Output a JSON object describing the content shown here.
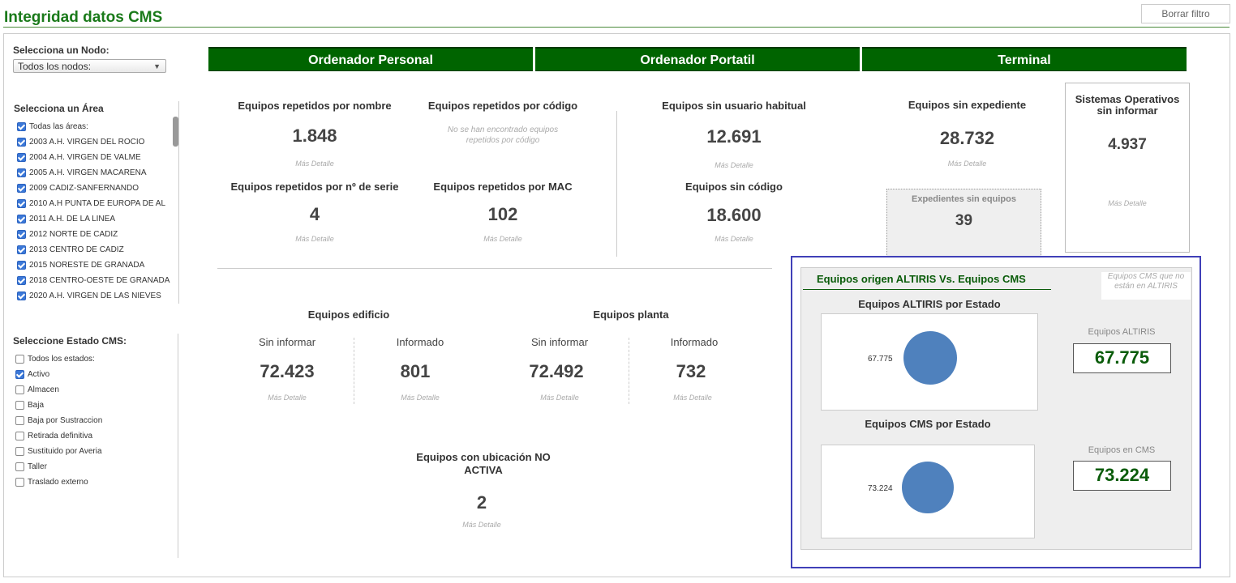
{
  "page": {
    "title": "Integridad datos CMS",
    "clear_filter": "Borrar filtro"
  },
  "filters": {
    "node_label": "Selecciona un Nodo:",
    "node_value": "Todos los nodos:",
    "area_label": "Selecciona un Área",
    "areas": [
      {
        "label": "Todas las áreas:",
        "checked": true
      },
      {
        "label": "2003 A.H. VIRGEN DEL ROCIO",
        "checked": true
      },
      {
        "label": "2004 A.H. VIRGEN DE VALME",
        "checked": true
      },
      {
        "label": "2005 A.H. VIRGEN MACARENA",
        "checked": true
      },
      {
        "label": "2009 CADIZ-SANFERNANDO",
        "checked": true
      },
      {
        "label": "2010 A.H PUNTA DE EUROPA DE AL",
        "checked": true
      },
      {
        "label": "2011 A.H. DE LA LINEA",
        "checked": true
      },
      {
        "label": "2012 NORTE DE CADIZ",
        "checked": true
      },
      {
        "label": "2013 CENTRO DE CADIZ",
        "checked": true
      },
      {
        "label": "2015 NORESTE DE GRANADA",
        "checked": true
      },
      {
        "label": "2018 CENTRO-OESTE DE GRANADA",
        "checked": true
      },
      {
        "label": "2020 A.H. VIRGEN DE LAS NIEVES",
        "checked": true
      }
    ],
    "estado_label": "Seleccione Estado CMS:",
    "estados": [
      {
        "label": "Todos los estados:",
        "checked": false
      },
      {
        "label": "Activo",
        "checked": true
      },
      {
        "label": "Almacen",
        "checked": false
      },
      {
        "label": "Baja",
        "checked": false
      },
      {
        "label": "Baja por Sustraccion",
        "checked": false
      },
      {
        "label": "Retirada definitiva",
        "checked": false
      },
      {
        "label": "Sustituido por Averia",
        "checked": false
      },
      {
        "label": "Taller",
        "checked": false
      },
      {
        "label": "Traslado externo",
        "checked": false
      }
    ]
  },
  "tabs": {
    "pc": "Ordenador Personal",
    "portatil": "Ordenador Portatil",
    "terminal": "Terminal"
  },
  "detail": "Más Detalle",
  "kpis": {
    "rep_nombre": {
      "title": "Equipos repetidos por nombre",
      "value": "1.848"
    },
    "rep_codigo": {
      "title": "Equipos repetidos por código",
      "note": "No se han encontrado equipos repetidos por código"
    },
    "rep_serie": {
      "title": "Equipos repetidos por nº de serie",
      "value": "4"
    },
    "rep_mac": {
      "title": "Equipos repetidos por MAC",
      "value": "102"
    },
    "sin_usuario": {
      "title": "Equipos sin usuario habitual",
      "value": "12.691"
    },
    "sin_codigo": {
      "title": "Equipos sin código",
      "value": "18.600"
    },
    "sin_expediente": {
      "title": "Equipos sin expediente",
      "value": "28.732"
    },
    "exp_sin_equipos": {
      "title": "Expedientes sin equipos",
      "value": "39"
    },
    "so_sin_informar": {
      "title": "Sistemas Operativos sin informar",
      "value": "4.937"
    },
    "edificio": {
      "title": "Equipos edificio",
      "sin_label": "Sin informar",
      "sin_value": "72.423",
      "inf_label": "Informado",
      "inf_value": "801"
    },
    "planta": {
      "title": "Equipos planta",
      "sin_label": "Sin informar",
      "sin_value": "72.492",
      "inf_label": "Informado",
      "inf_value": "732"
    },
    "ubicacion": {
      "title": "Equipos con ubicación NO ACTIVA",
      "value": "2"
    }
  },
  "compare": {
    "title": "Equipos origen ALTIRIS Vs. Equipos CMS",
    "note": "Equipos CMS que no están en ALTIRIS",
    "altiris_chart_title": "Equipos ALTIRIS por Estado",
    "cms_chart_title": "Equipos CMS por Estado",
    "altiris_label": "Equipos ALTIRIS",
    "altiris_value": "67.775",
    "cms_label": "Equipos en CMS",
    "cms_value": "73.224",
    "pie_color": "#4f81bd"
  }
}
